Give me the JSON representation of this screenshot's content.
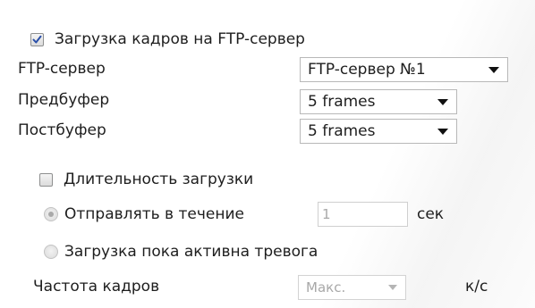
{
  "upload": {
    "label": "Загрузка кадров на FTP-сервер",
    "checked": true
  },
  "ftp_server": {
    "label": "FTP-сервер",
    "value": "FTP-сервер №1"
  },
  "prebuffer": {
    "label": "Предбуфер",
    "value": "5 frames"
  },
  "postbuffer": {
    "label": "Постбуфер",
    "value": "5 frames"
  },
  "duration": {
    "label": "Длительность загрузки",
    "checked": false
  },
  "send_during": {
    "label": "Отправлять в течение",
    "value": "1",
    "unit": "сек",
    "selected": true
  },
  "while_alarm": {
    "label": "Загрузка пока активна тревога",
    "selected": false
  },
  "frame_rate": {
    "label": "Частота кадров",
    "value": "Макс.",
    "unit": "к/с"
  }
}
